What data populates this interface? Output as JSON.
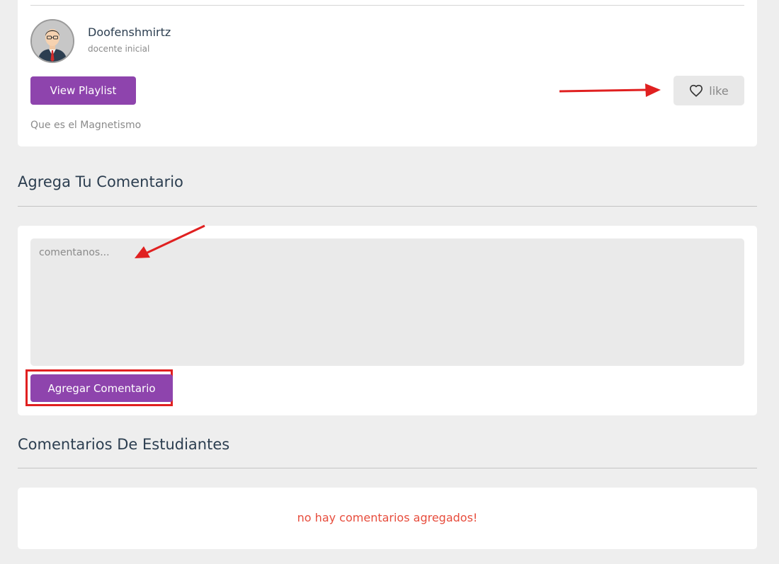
{
  "video": {
    "tutor_name": "Doofenshmirtz",
    "tutor_role": "docente inicial",
    "view_playlist_label": "View Playlist",
    "like_label": "like",
    "description": "Que es el Magnetismo"
  },
  "add_comment": {
    "heading": "Agrega Tu Comentario",
    "placeholder": "comentanos...",
    "submit_label": "Agregar Comentario"
  },
  "student_comments": {
    "heading": "Comentarios De Estudiantes",
    "empty_message": "no hay comentarios agregados!"
  },
  "icons": {
    "avatar": "teacher-avatar-icon",
    "like": "heart-outline-icon"
  },
  "colors": {
    "accent": "#8e44ad",
    "empty_message": "#e74c3c",
    "annotation": "#e02020",
    "background": "#eeeeee"
  }
}
